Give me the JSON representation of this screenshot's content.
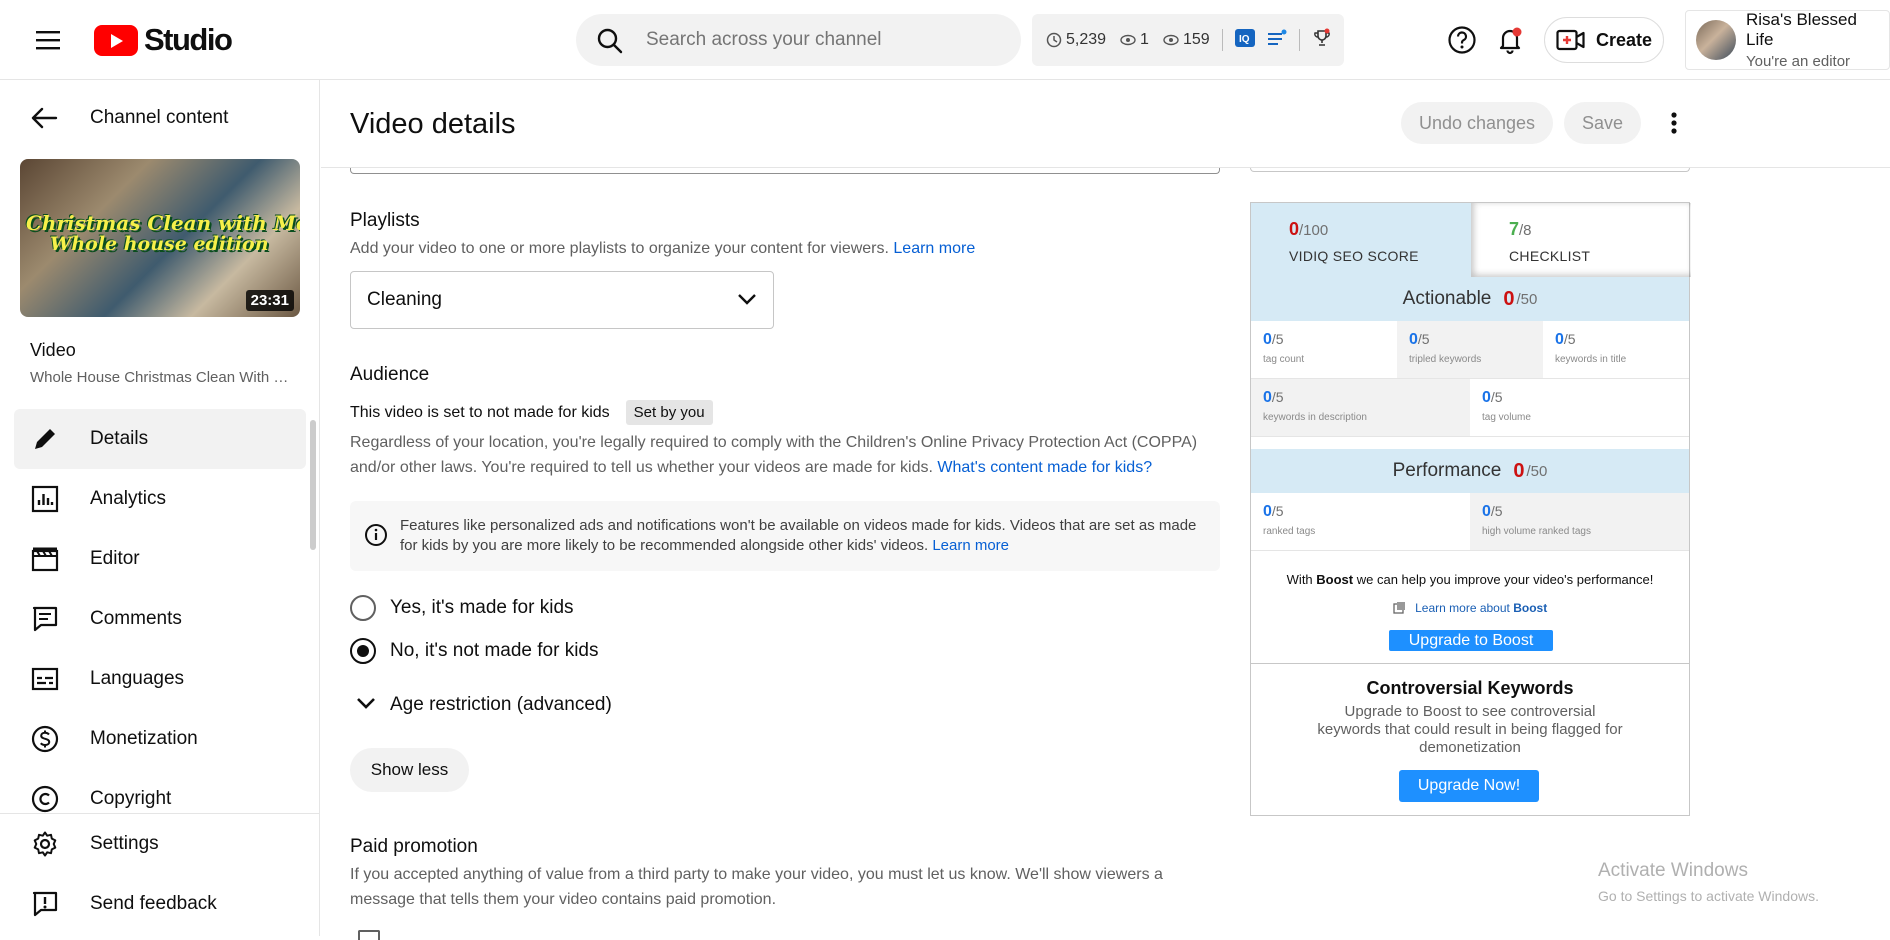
{
  "topbar": {
    "logo_text": "Studio",
    "search_placeholder": "Search across your channel",
    "stats": {
      "watch_hours": "5,239",
      "views_live": "1",
      "views": "159"
    },
    "create_label": "Create",
    "user_name": "Risa's Blessed Life",
    "user_role": "You're an editor"
  },
  "sidebar": {
    "back_label": "Channel content",
    "thumb": {
      "line1": "Christmas Clean with Me",
      "line2": "Whole house edition",
      "duration": "23:31"
    },
    "video_label": "Video",
    "video_title": "Whole House Christmas Clean With Me",
    "items": [
      {
        "label": "Details",
        "icon": "pencil-icon"
      },
      {
        "label": "Analytics",
        "icon": "analytics-icon"
      },
      {
        "label": "Editor",
        "icon": "clapperboard-icon"
      },
      {
        "label": "Comments",
        "icon": "comments-icon"
      },
      {
        "label": "Languages",
        "icon": "subtitles-icon"
      },
      {
        "label": "Monetization",
        "icon": "dollar-icon"
      },
      {
        "label": "Copyright",
        "icon": "copyright-icon"
      }
    ],
    "bottom_items": [
      {
        "label": "Settings",
        "icon": "gear-icon"
      },
      {
        "label": "Send feedback",
        "icon": "feedback-icon"
      }
    ]
  },
  "header": {
    "title": "Video details",
    "undo_label": "Undo changes",
    "save_label": "Save"
  },
  "playlists": {
    "title": "Playlists",
    "desc": "Add your video to one or more playlists to organize your content for viewers.",
    "learn_more": "Learn more",
    "selected": "Cleaning"
  },
  "audience": {
    "title": "Audience",
    "status": "This video is set to not made for kids",
    "chip": "Set by you",
    "desc_line1": "Regardless of your location, you're legally required to comply with the Children's Online Privacy Protection Act (COPPA)",
    "desc_line2": "and/or other laws. You're required to tell us whether your videos are made for kids.",
    "desc_link": "What's content made for kids?",
    "info_text": "Features like personalized ads and notifications won't be available on videos made for kids. Videos that are set as made for kids by you are more likely to be recommended alongside other kids' videos.",
    "info_link": "Learn more",
    "option_yes": "Yes, it's made for kids",
    "option_no": "No, it's not made for kids",
    "selected_option": "no",
    "age_restriction": "Age restriction (advanced)",
    "show_less": "Show less"
  },
  "paid_promotion": {
    "title": "Paid promotion",
    "desc_line1": "If you accepted anything of value from a third party to make your video, you must let us know. We'll show viewers a",
    "desc_line2": "message that tells them your video contains paid promotion."
  },
  "vidiq": {
    "seo_score": "0",
    "seo_den": "/100",
    "seo_label": "VIDIQ SEO SCORE",
    "checklist_score": "7",
    "checklist_den": "/8",
    "checklist_label": "CHECKLIST",
    "actionable_label": "Actionable",
    "actionable_score": "0",
    "actionable_den": "/50",
    "actionable_cells": [
      {
        "score": "0",
        "den": "/5",
        "label": "tag count"
      },
      {
        "score": "0",
        "den": "/5",
        "label": "tripled keywords"
      },
      {
        "score": "0",
        "den": "/5",
        "label": "keywords in title"
      },
      {
        "score": "0",
        "den": "/5",
        "label": "keywords in description"
      },
      {
        "score": "0",
        "den": "/5",
        "label": "tag volume"
      }
    ],
    "performance_label": "Performance",
    "performance_score": "0",
    "performance_den": "/50",
    "performance_cells": [
      {
        "score": "0",
        "den": "/5",
        "label": "ranked tags"
      },
      {
        "score": "0",
        "den": "/5",
        "label": "high volume ranked tags"
      }
    ],
    "boost_pre": "With",
    "boost_word": "Boost",
    "boost_post": "we can help you improve your video's performance!",
    "boost_link_pre": "Learn more about",
    "boost_link_word": "Boost",
    "boost_button": "Upgrade to Boost",
    "ck_title": "Controversial Keywords",
    "ck_desc": "Upgrade to Boost to see controversial keywords that could result in being flagged for demonetization",
    "ck_button": "Upgrade Now!"
  },
  "watermark": {
    "line1": "Activate Windows",
    "line2": "Go to Settings to activate Windows."
  },
  "colors": {
    "accent": "#065fd4",
    "brand_red": "#ff0000",
    "vidiq_blue": "#1e90ff",
    "score_red": "#cc1111",
    "score_green": "#4caf50"
  }
}
